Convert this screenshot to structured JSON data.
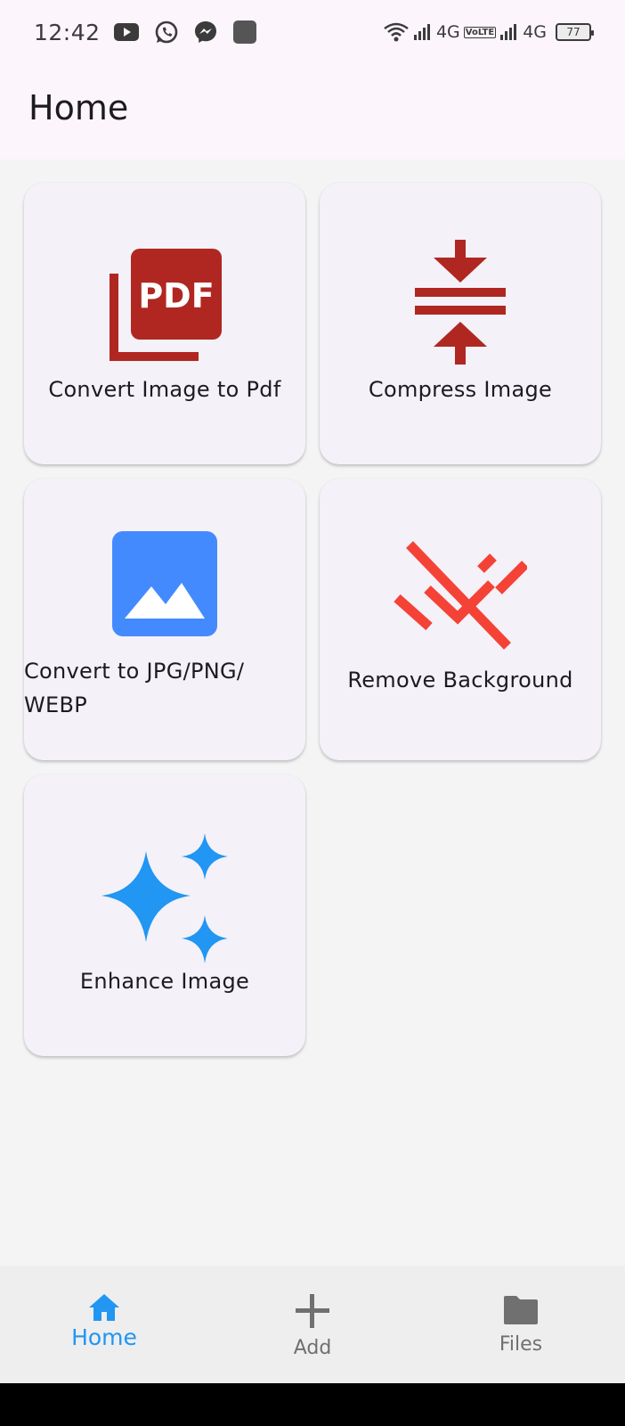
{
  "status_bar": {
    "time": "12:42",
    "network_1": "4G",
    "volte": "VoLTE",
    "network_2": "4G",
    "battery": "77",
    "left_icons": [
      "youtube-icon",
      "whatsapp-icon",
      "messenger-icon",
      "app-icon"
    ],
    "right_icons": [
      "wifi-icon",
      "signal-icon",
      "volte-icon",
      "signal-icon",
      "battery-icon"
    ]
  },
  "app_bar": {
    "title": "Home"
  },
  "cards": [
    {
      "label": "Convert Image to Pdf",
      "icon": "pdf-icon",
      "color": "#b02722"
    },
    {
      "label": "Compress Image",
      "icon": "compress-icon",
      "color": "#b02722"
    },
    {
      "label_line1": "Convert to JPG/PNG/",
      "label_line2": "WEBP",
      "icon": "image-icon",
      "color": "#448aff"
    },
    {
      "label": "Remove Background",
      "icon": "remove-background-icon",
      "color": "#f44336"
    },
    {
      "label": "Enhance Image",
      "icon": "sparkle-icon",
      "color": "#2196f3"
    }
  ],
  "bottom_nav": {
    "items": [
      {
        "label": "Home",
        "icon": "home-icon",
        "active": true
      },
      {
        "label": "Add",
        "icon": "plus-icon",
        "active": false
      },
      {
        "label": "Files",
        "icon": "folder-icon",
        "active": false
      }
    ],
    "active_color": "#2196f3",
    "inactive_color": "#707070"
  }
}
